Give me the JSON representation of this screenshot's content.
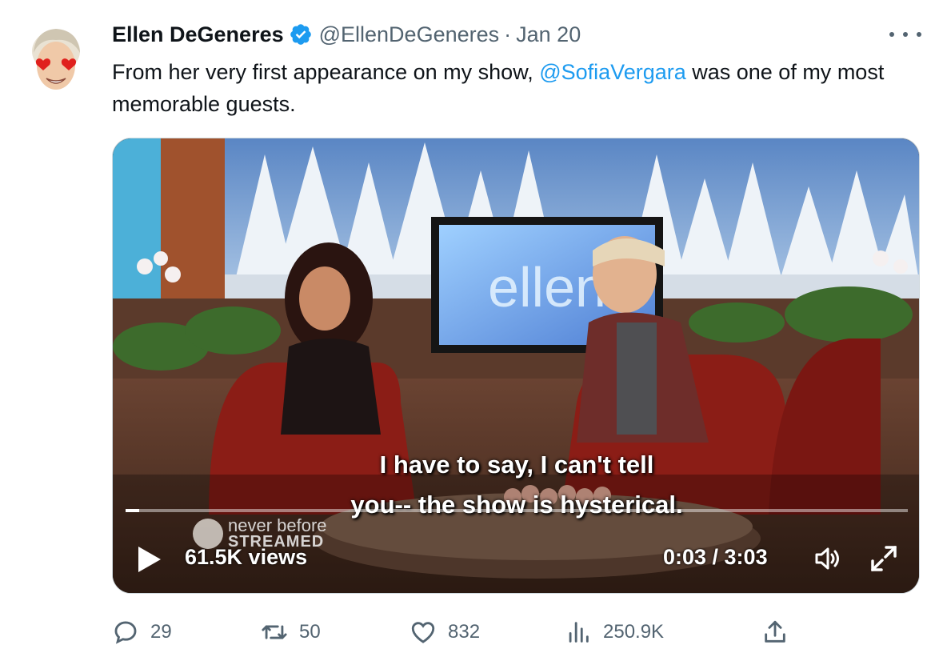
{
  "tweet": {
    "author_name": "Ellen DeGeneres",
    "handle": "@EllenDeGeneres",
    "separator": "·",
    "date": "Jan 20",
    "text_before": "From her very first appearance on my show, ",
    "mention": "@SofiaVergara",
    "text_after": " was one of my most memorable guests."
  },
  "video": {
    "subtitle_line1": "I have to say, I can't tell",
    "subtitle_line2": "you-- the show is hysterical.",
    "tv_logo_text": "ellen",
    "watermark_line1": "never before",
    "watermark_line2": "STREAMED",
    "views": "61.5K views",
    "time": "0:03 / 3:03",
    "progress": 0.017
  },
  "actions": {
    "replies": "29",
    "retweets": "50",
    "likes": "832",
    "views": "250.9K"
  },
  "colors": {
    "accent": "#1d9bf0",
    "secondary_text": "#536471",
    "primary_text": "#0f1419"
  },
  "icons": [
    "verified-icon",
    "more-icon",
    "play-icon",
    "volume-icon",
    "fullscreen-icon",
    "reply-icon",
    "retweet-icon",
    "like-icon",
    "views-icon",
    "share-icon"
  ]
}
